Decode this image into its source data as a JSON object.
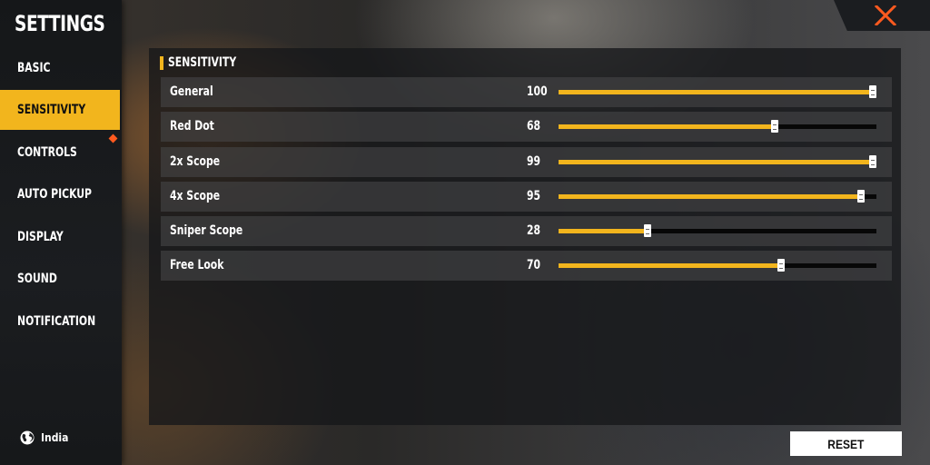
{
  "sidebar": {
    "title": "SETTINGS",
    "items": [
      {
        "label": "BASIC",
        "active": false
      },
      {
        "label": "SENSITIVITY",
        "active": true
      },
      {
        "label": "CONTROLS",
        "active": false,
        "notification": true
      },
      {
        "label": "AUTO PICKUP",
        "active": false
      },
      {
        "label": "DISPLAY",
        "active": false
      },
      {
        "label": "SOUND",
        "active": false
      },
      {
        "label": "NOTIFICATION",
        "active": false
      }
    ],
    "region": {
      "label": "India",
      "icon": "globe-icon"
    }
  },
  "header": {
    "close_icon": "close-icon"
  },
  "panel": {
    "section_title": "SENSITIVITY",
    "sliders": [
      {
        "label": "General",
        "value": "100",
        "level": 100,
        "max": 100
      },
      {
        "label": "Red Dot",
        "value": "68",
        "level": 68,
        "max": 100
      },
      {
        "label": "2x Scope",
        "value": "99",
        "level": 99,
        "max": 100
      },
      {
        "label": "4x Scope",
        "value": "95",
        "level": 95,
        "max": 100
      },
      {
        "label": "Sniper Scope",
        "value": "28",
        "level": 28,
        "max": 100
      },
      {
        "label": "Free Look",
        "value": "70",
        "level": 70,
        "max": 100
      }
    ]
  },
  "footer": {
    "reset_label": "RESET"
  },
  "colors": {
    "accent": "#f2b51d",
    "close": "#ff5a1f",
    "notification_dot": "#ff5a1f"
  }
}
